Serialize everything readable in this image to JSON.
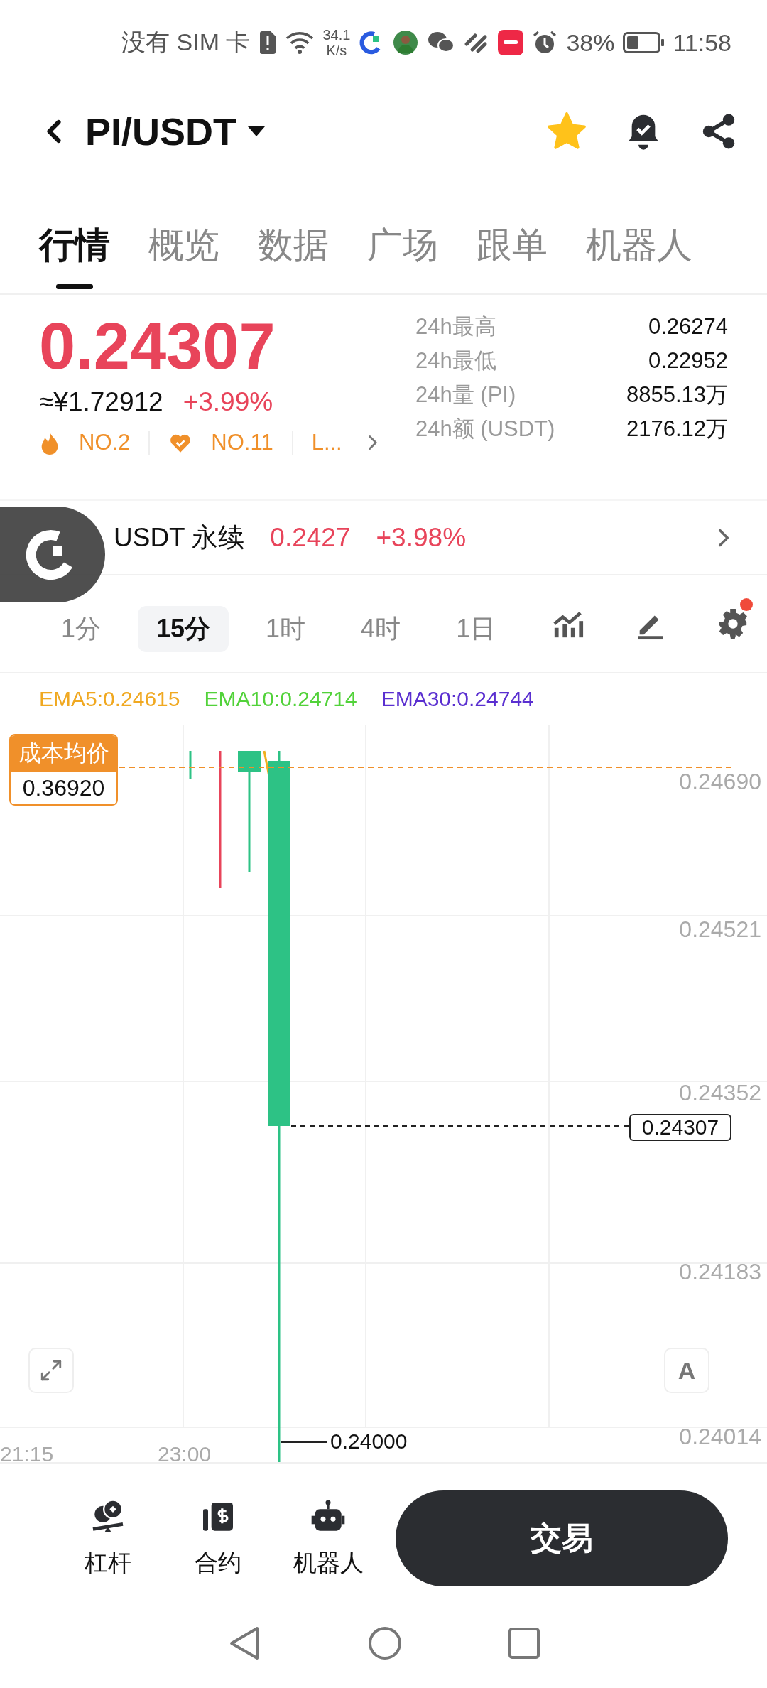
{
  "status_bar": {
    "carrier": "没有 SIM 卡",
    "speed": [
      "34.1",
      "K/s"
    ],
    "battery": "38%",
    "time": "11:58"
  },
  "header": {
    "pair": "PI/USDT",
    "favorite": true
  },
  "tabs": [
    {
      "label": "行情",
      "selected": true
    },
    {
      "label": "概览",
      "selected": false
    },
    {
      "label": "数据",
      "selected": false
    },
    {
      "label": "广场",
      "selected": false
    },
    {
      "label": "跟单",
      "selected": false
    },
    {
      "label": "机器人",
      "selected": false
    }
  ],
  "price": {
    "last": "0.24307",
    "cny": "≈¥1.72912",
    "change": "+3.99%"
  },
  "ranks": [
    {
      "kind": "hot",
      "text": "NO.2"
    },
    {
      "kind": "favorite",
      "text": "NO.11"
    },
    {
      "kind": "plain",
      "text": "L..."
    }
  ],
  "stats": [
    {
      "label": "24h最高",
      "value": "0.26274"
    },
    {
      "label": "24h最低",
      "value": "0.22952"
    },
    {
      "label": "24h量 (PI)",
      "value": "8855.13万"
    },
    {
      "label": "24h额 (USDT)",
      "value": "2176.12万"
    }
  ],
  "perpetual": {
    "name": "USDT 永续",
    "price": "0.2427",
    "change": "+3.98%"
  },
  "intervals": [
    {
      "label": "1分",
      "selected": false
    },
    {
      "label": "15分",
      "selected": true
    },
    {
      "label": "1时",
      "selected": false
    },
    {
      "label": "4时",
      "selected": false
    },
    {
      "label": "1日",
      "selected": false
    }
  ],
  "settings_badge": true,
  "ema": [
    {
      "label": "EMA5:0.24615",
      "color": "#f0a820"
    },
    {
      "label": "EMA10:0.24714",
      "color": "#52d23a"
    },
    {
      "label": "EMA30:0.24744",
      "color": "#5a2fd0"
    }
  ],
  "chart": {
    "y_labels": [
      "0.24690",
      "0.24521",
      "0.24352",
      "0.24183",
      "0.24014"
    ],
    "x_labels": [
      "21:15",
      "23:00"
    ],
    "cost_label": "成本均价",
    "cost_value": "0.36920",
    "last_price": "0.24307",
    "low": "0.24000",
    "auto_label": "A"
  },
  "bottom_nav": [
    {
      "kind": "leverage",
      "label": "杠杆"
    },
    {
      "kind": "contract",
      "label": "合约"
    },
    {
      "kind": "robot",
      "label": "机器人"
    }
  ],
  "trade_button": "交易"
}
